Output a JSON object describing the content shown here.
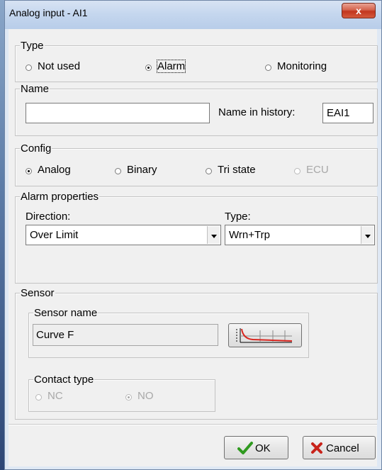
{
  "window": {
    "title": "Analog input - AI1",
    "close_label": "x"
  },
  "type_group": {
    "label": "Type",
    "options": [
      {
        "label": "Not used",
        "selected": false
      },
      {
        "label": "Alarm",
        "selected": true
      },
      {
        "label": "Monitoring",
        "selected": false
      }
    ]
  },
  "name_group": {
    "label": "Name",
    "name_value": "",
    "history_label": "Name in history:",
    "history_value": "EAI1"
  },
  "config_group": {
    "label": "Config",
    "options": [
      {
        "label": "Analog",
        "selected": true,
        "enabled": true
      },
      {
        "label": "Binary",
        "selected": false,
        "enabled": true
      },
      {
        "label": "Tri state",
        "selected": false,
        "enabled": true
      },
      {
        "label": "ECU",
        "selected": false,
        "enabled": false
      }
    ]
  },
  "alarm_group": {
    "label": "Alarm properties",
    "direction_label": "Direction:",
    "direction_value": "Over Limit",
    "type_label": "Type:",
    "type_value": "Wrn+Trp"
  },
  "sensor_group": {
    "label": "Sensor",
    "sensor_name_label": "Sensor name",
    "sensor_name_value": "Curve F",
    "contact_type_label": "Contact type",
    "contact_options": [
      {
        "label": "NC",
        "selected": false
      },
      {
        "label": "NO",
        "selected": true
      }
    ]
  },
  "footer": {
    "ok_label": "OK",
    "cancel_label": "Cancel"
  },
  "colors": {
    "ok_check": "#2f9a1f",
    "cancel_x": "#c8231a",
    "curve": "#d8261f"
  },
  "icons": [
    "close-icon",
    "curve-chart-icon",
    "check-icon",
    "x-icon"
  ]
}
